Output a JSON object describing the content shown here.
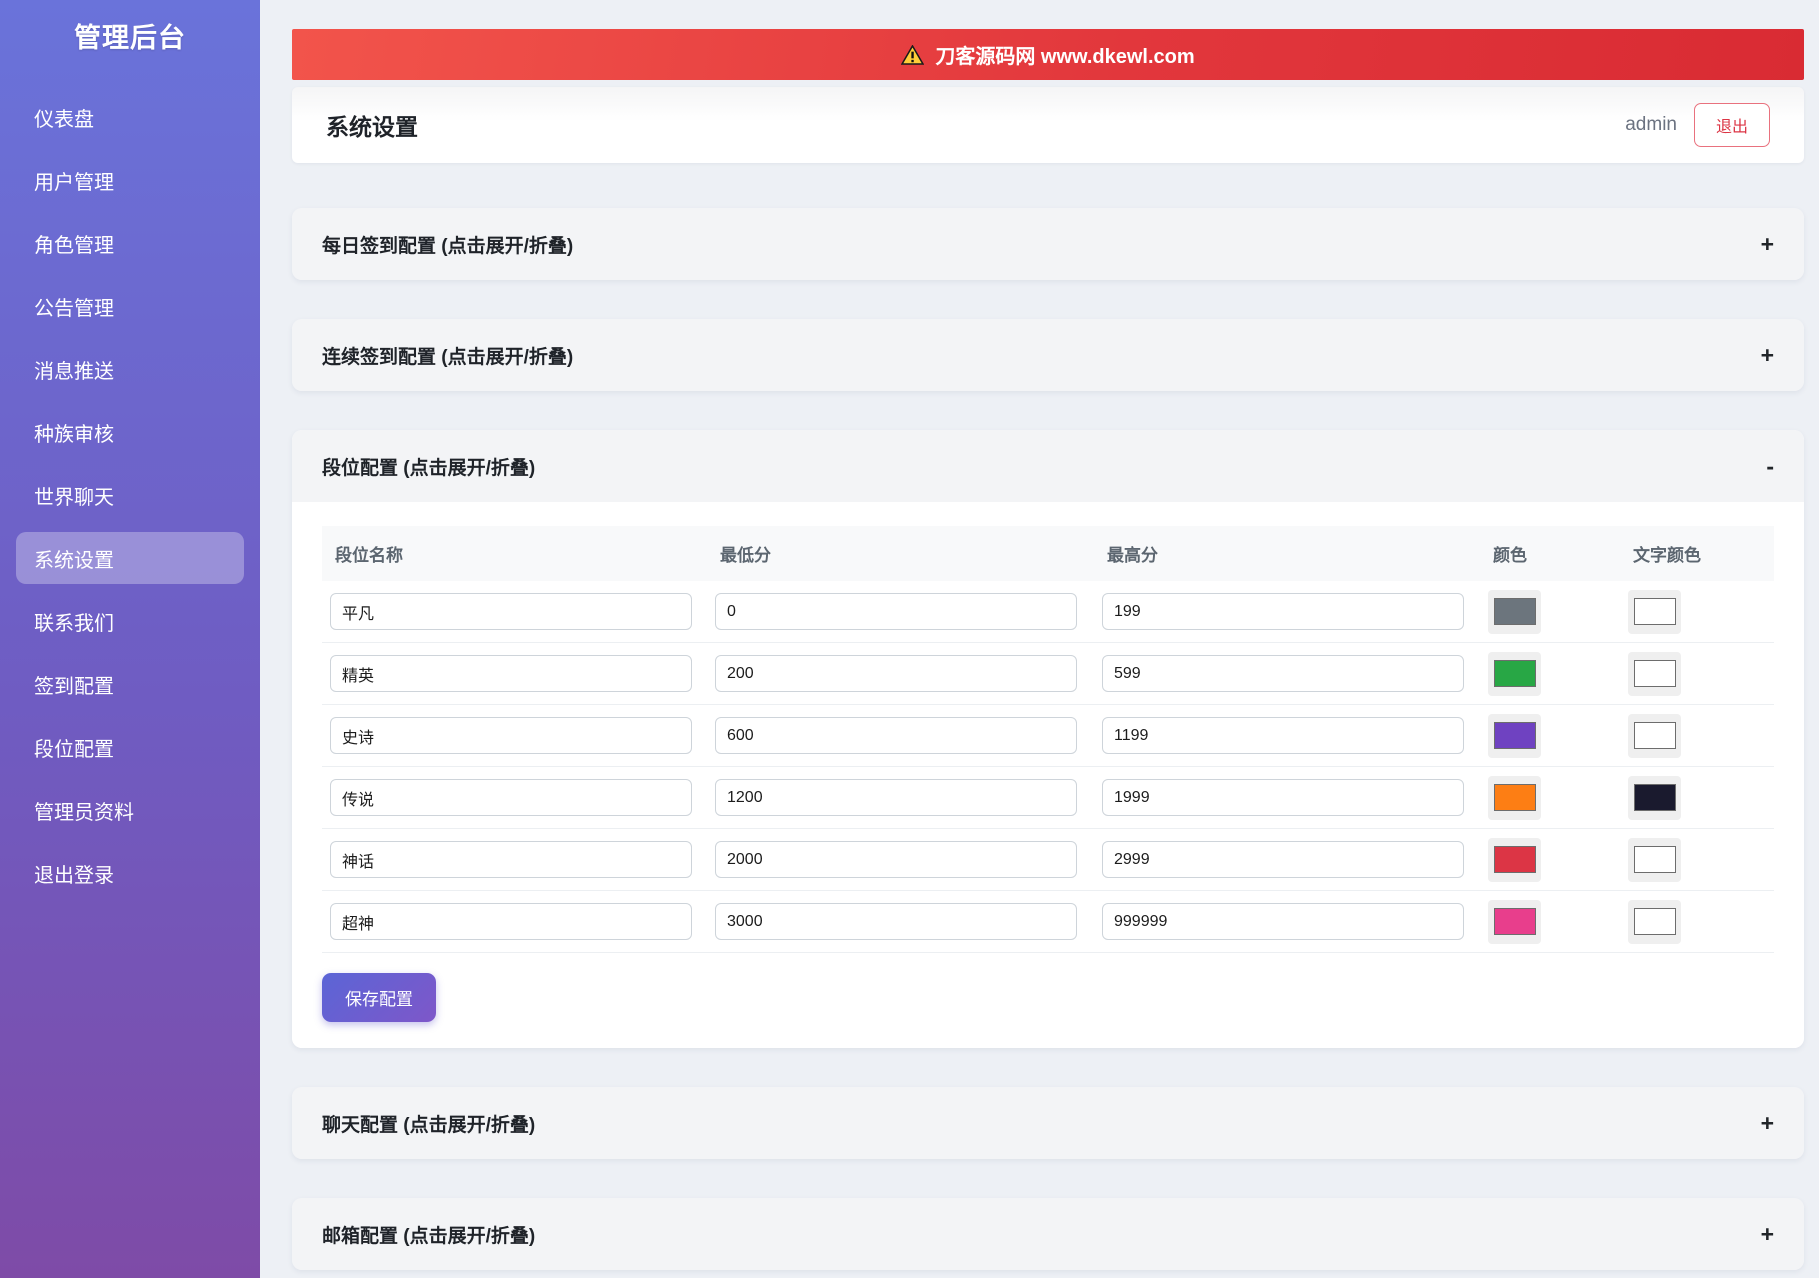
{
  "sidebar": {
    "title": "管理后台",
    "items": [
      {
        "id": "dashboard",
        "label": "仪表盘",
        "active": false
      },
      {
        "id": "user-mgmt",
        "label": "用户管理",
        "active": false
      },
      {
        "id": "role-mgmt",
        "label": "角色管理",
        "active": false
      },
      {
        "id": "announce-mgmt",
        "label": "公告管理",
        "active": false
      },
      {
        "id": "message-push",
        "label": "消息推送",
        "active": false
      },
      {
        "id": "race-review",
        "label": "种族审核",
        "active": false
      },
      {
        "id": "world-chat",
        "label": "世界聊天",
        "active": false
      },
      {
        "id": "system-settings",
        "label": "系统设置",
        "active": true
      },
      {
        "id": "contact-us",
        "label": "联系我们",
        "active": false
      },
      {
        "id": "signin-config",
        "label": "签到配置",
        "active": false
      },
      {
        "id": "rank-config",
        "label": "段位配置",
        "active": false
      },
      {
        "id": "admin-profile",
        "label": "管理员资料",
        "active": false
      },
      {
        "id": "logout",
        "label": "退出登录",
        "active": false
      }
    ]
  },
  "banner": {
    "text": "刀客源码网 www.dkewl.com",
    "icon": "warning-triangle",
    "background": "#e2373c"
  },
  "header": {
    "title": "系统设置",
    "username": "admin",
    "logout_label": "退出"
  },
  "sections": [
    {
      "id": "daily-signin",
      "title": "每日签到配置 (点击展开/折叠)",
      "toggle": "+",
      "expanded": false
    },
    {
      "id": "streak-signin",
      "title": "连续签到配置 (点击展开/折叠)",
      "toggle": "+",
      "expanded": false
    },
    {
      "id": "rank-config",
      "title": "段位配置 (点击展开/折叠)",
      "toggle": "-",
      "expanded": true
    },
    {
      "id": "chat-config",
      "title": "聊天配置 (点击展开/折叠)",
      "toggle": "+",
      "expanded": false
    },
    {
      "id": "mail-config",
      "title": "邮箱配置 (点击展开/折叠)",
      "toggle": "+",
      "expanded": false
    }
  ],
  "rank_table": {
    "columns": [
      "段位名称",
      "最低分",
      "最高分",
      "颜色",
      "文字颜色"
    ],
    "rows": [
      {
        "name": "平凡",
        "min": "0",
        "max": "199",
        "color": "#6c757d",
        "text_color": "#ffffff"
      },
      {
        "name": "精英",
        "min": "200",
        "max": "599",
        "color": "#28a745",
        "text_color": "#ffffff"
      },
      {
        "name": "史诗",
        "min": "600",
        "max": "1199",
        "color": "#6f42c1",
        "text_color": "#ffffff"
      },
      {
        "name": "传说",
        "min": "1200",
        "max": "1999",
        "color": "#fd7e14",
        "text_color": "#1a1a2e"
      },
      {
        "name": "神话",
        "min": "2000",
        "max": "2999",
        "color": "#dc3545",
        "text_color": "#ffffff"
      },
      {
        "name": "超神",
        "min": "3000",
        "max": "999999",
        "color": "#e83e8c",
        "text_color": "#ffffff"
      }
    ],
    "save_label": "保存配置"
  },
  "colors": {
    "sidebar_gradient_top": "#6a73da",
    "sidebar_gradient_bottom": "#7e4ba7",
    "page_background": "#edf0f5",
    "banner_red": "#e2373c",
    "logout_red": "#dc3545",
    "save_button_gradient_start": "#5b65d6",
    "save_button_gradient_end": "#7e57c9",
    "section_header_bg": "#f3f4f6",
    "table_header_bg": "#f8f9fa"
  }
}
